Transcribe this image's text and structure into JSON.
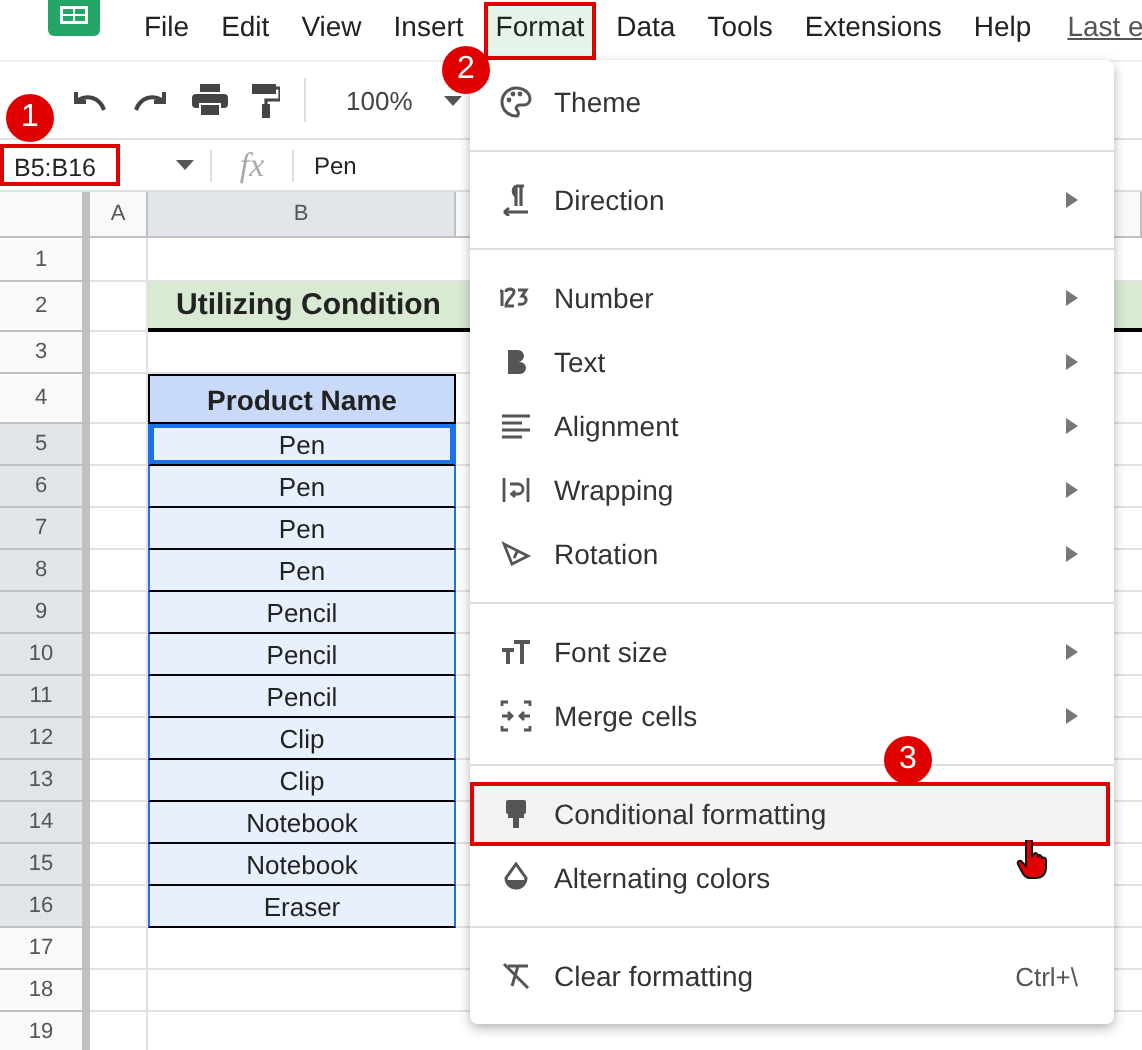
{
  "menubar": {
    "items": [
      {
        "label": "File",
        "selected": false,
        "highlighted": false
      },
      {
        "label": "Edit",
        "selected": false,
        "highlighted": false
      },
      {
        "label": "View",
        "selected": false,
        "highlighted": false
      },
      {
        "label": "Insert",
        "selected": false,
        "highlighted": false
      },
      {
        "label": "Format",
        "selected": true,
        "highlighted": true
      },
      {
        "label": "Data",
        "selected": false,
        "highlighted": false
      },
      {
        "label": "Tools",
        "selected": false,
        "highlighted": false
      },
      {
        "label": "Extensions",
        "selected": false,
        "highlighted": false
      },
      {
        "label": "Help",
        "selected": false,
        "highlighted": false
      }
    ],
    "last_edit": "Last e"
  },
  "toolbar": {
    "zoom": "100%"
  },
  "formula_bar": {
    "name_box": "B5:B16",
    "name_box_highlighted": true,
    "fx": "fx",
    "value": "Pen"
  },
  "grid": {
    "columns": [
      "A",
      "B"
    ],
    "row_numbers": [
      "1",
      "2",
      "3",
      "4",
      "5",
      "6",
      "7",
      "8",
      "9",
      "10",
      "11",
      "12",
      "13",
      "14",
      "15",
      "16",
      "17",
      "18",
      "19"
    ],
    "title": "Utilizing Condition",
    "header": "Product Name",
    "rows": [
      {
        "value": "Pen",
        "selected": true
      },
      {
        "value": "Pen",
        "selected": true
      },
      {
        "value": "Pen",
        "selected": true
      },
      {
        "value": "Pen",
        "selected": true
      },
      {
        "value": "Pencil",
        "selected": true
      },
      {
        "value": "Pencil",
        "selected": true
      },
      {
        "value": "Pencil",
        "selected": true
      },
      {
        "value": "Clip",
        "selected": true
      },
      {
        "value": "Clip",
        "selected": true
      },
      {
        "value": "Notebook",
        "selected": true
      },
      {
        "value": "Notebook",
        "selected": true
      },
      {
        "value": "Eraser",
        "selected": true
      }
    ]
  },
  "format_menu": {
    "items": [
      {
        "kind": "item",
        "label": "Theme",
        "submenu": false,
        "highlighted": false
      },
      {
        "kind": "divider"
      },
      {
        "kind": "item",
        "label": "Direction",
        "submenu": true,
        "highlighted": false
      },
      {
        "kind": "divider"
      },
      {
        "kind": "item",
        "label": "Number",
        "submenu": true,
        "highlighted": false
      },
      {
        "kind": "item",
        "label": "Text",
        "submenu": true,
        "highlighted": false
      },
      {
        "kind": "item",
        "label": "Alignment",
        "submenu": true,
        "highlighted": false
      },
      {
        "kind": "item",
        "label": "Wrapping",
        "submenu": true,
        "highlighted": false
      },
      {
        "kind": "item",
        "label": "Rotation",
        "submenu": true,
        "highlighted": false
      },
      {
        "kind": "divider"
      },
      {
        "kind": "item",
        "label": "Font size",
        "submenu": true,
        "highlighted": false
      },
      {
        "kind": "item",
        "label": "Merge cells",
        "submenu": true,
        "highlighted": false
      },
      {
        "kind": "divider"
      },
      {
        "kind": "item",
        "label": "Conditional formatting",
        "submenu": false,
        "highlighted": true
      },
      {
        "kind": "item",
        "label": "Alternating colors",
        "submenu": false,
        "highlighted": false
      },
      {
        "kind": "divider"
      },
      {
        "kind": "item",
        "label": "Clear formatting",
        "submenu": false,
        "highlighted": false,
        "shortcut": "Ctrl+\\"
      }
    ]
  },
  "annotations": [
    {
      "number": "1"
    },
    {
      "number": "2"
    },
    {
      "number": "3"
    }
  ]
}
